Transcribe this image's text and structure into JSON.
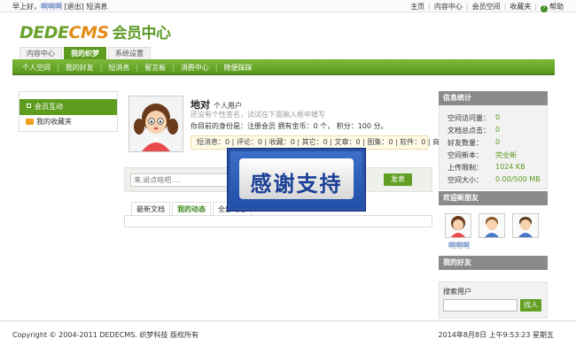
{
  "topbar": {
    "greeting": "早上好，",
    "username": "啊啊啊",
    "logout": "[退出]",
    "messages": "短消息",
    "links": [
      "主页",
      "内容中心",
      "会员空间",
      "收藏夹"
    ],
    "help": "帮助"
  },
  "logo": {
    "dede": "DEDE",
    "cms": "CMS",
    "member": "会员中心"
  },
  "main_tabs": [
    {
      "label": "内容中心",
      "active": false
    },
    {
      "label": "我的织梦",
      "active": true
    },
    {
      "label": "系统设置",
      "active": false
    }
  ],
  "subnav": [
    "个人空间",
    "我的好友",
    "短消息",
    "留言板",
    "消费中心",
    "随便踩踩"
  ],
  "left": {
    "section": "会员互动",
    "items": [
      "我的收藏夹"
    ]
  },
  "profile": {
    "name": "地对",
    "type": "个人用户",
    "signature": "还没有个性签名，试试在下面输入框中填写",
    "identity": "你目前的身份是：注册会员 拥有金币：0 个， 积分：100 分。",
    "stats": "短消息：0 | 评论：0 | 收藏：0 | 其它：0 | 文章：0 | 图集：0 | 软件：0 | 商品：0"
  },
  "post": {
    "placeholder": "来,说点啥吧.....",
    "button": "发表"
  },
  "content_tabs": [
    "最新文档",
    "我的动态",
    "全部动态"
  ],
  "overlay": {
    "text": "感谢支持"
  },
  "right": {
    "info_title": "信息统计",
    "stats": [
      {
        "label": "空间访问量：",
        "value": "0"
      },
      {
        "label": "文档总点击：",
        "value": "0"
      },
      {
        "label": "好友数量：",
        "value": "0"
      },
      {
        "label": "空间新本：",
        "value": "完全新"
      },
      {
        "label": "上传限制：",
        "value": "1024 KB"
      },
      {
        "label": "空间大小：",
        "value": "0.00/500 MB"
      }
    ],
    "new_friends_title": "欢迎新朋友",
    "new_friend_name": "啊啊啊",
    "my_friends_title": "我的好友",
    "search_label": "搜索用户",
    "search_button": "找人"
  },
  "footer": {
    "copyright": "Copyright © 2004-2011 DEDECMS. 织梦科技 版权所有",
    "datetime": "2014年8月8日 上午9:53:23 星期五"
  },
  "colors": {
    "accent": "#5e9c1f",
    "cms_orange": "#e48a17",
    "link_blue": "#2a59a8",
    "overlay_blue": "#2b52a8"
  }
}
